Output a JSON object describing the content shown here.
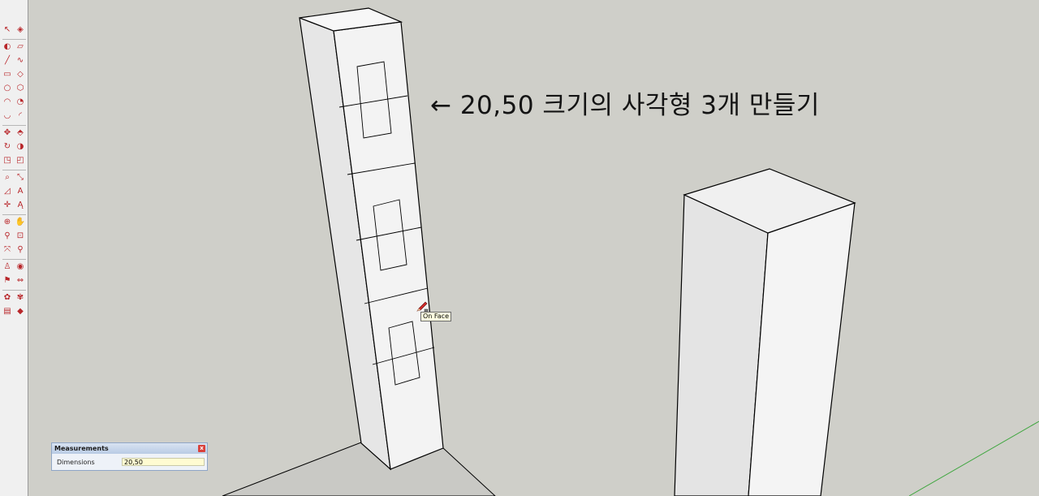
{
  "annotation": "← 20,50 크기의 사각형 3개 만들기",
  "tooltip": "On Face",
  "measurements": {
    "title": "Measurements",
    "close_glyph": "x",
    "label": "Dimensions",
    "value": "20,50"
  },
  "toolbar": {
    "tools": [
      {
        "name": "select-tool",
        "glyph": "↖"
      },
      {
        "name": "make-component-tool",
        "glyph": "◈"
      },
      {
        "name": "paint-bucket-tool",
        "glyph": "◐"
      },
      {
        "name": "eraser-tool",
        "glyph": "▱"
      },
      {
        "name": "line-tool",
        "glyph": "╱"
      },
      {
        "name": "freehand-tool",
        "glyph": "∿"
      },
      {
        "name": "rectangle-tool",
        "glyph": "▭"
      },
      {
        "name": "rotated-rectangle-tool",
        "glyph": "◇"
      },
      {
        "name": "circle-tool",
        "glyph": "○"
      },
      {
        "name": "polygon-tool",
        "glyph": "⬡"
      },
      {
        "name": "arc-tool",
        "glyph": "◠"
      },
      {
        "name": "pie-tool",
        "glyph": "◔"
      },
      {
        "name": "two-point-arc-tool",
        "glyph": "◡"
      },
      {
        "name": "three-point-arc-tool",
        "glyph": "◜"
      },
      {
        "name": "move-tool",
        "glyph": "✥"
      },
      {
        "name": "push-pull-tool",
        "glyph": "⬘"
      },
      {
        "name": "rotate-tool",
        "glyph": "↻"
      },
      {
        "name": "follow-me-tool",
        "glyph": "◑"
      },
      {
        "name": "scale-tool",
        "glyph": "◳"
      },
      {
        "name": "offset-tool",
        "glyph": "◰"
      },
      {
        "name": "tape-measure-tool",
        "glyph": "⌕"
      },
      {
        "name": "dimension-tool",
        "glyph": "⤡"
      },
      {
        "name": "protractor-tool",
        "glyph": "◿"
      },
      {
        "name": "text-tool",
        "glyph": "A"
      },
      {
        "name": "axes-tool",
        "glyph": "✛"
      },
      {
        "name": "3d-text-tool",
        "glyph": "Ą"
      },
      {
        "name": "orbit-tool",
        "glyph": "⊕"
      },
      {
        "name": "pan-tool",
        "glyph": "✋"
      },
      {
        "name": "zoom-tool",
        "glyph": "⚲"
      },
      {
        "name": "zoom-window-tool",
        "glyph": "⊡"
      },
      {
        "name": "zoom-extents-tool",
        "glyph": "⤧"
      },
      {
        "name": "previous-view-tool",
        "glyph": "⚲"
      },
      {
        "name": "position-camera-tool",
        "glyph": "♙"
      },
      {
        "name": "look-around-tool",
        "glyph": "◉"
      },
      {
        "name": "walk-tool",
        "glyph": "⚑"
      },
      {
        "name": "section-plane-tool",
        "glyph": "⇔"
      },
      {
        "name": "warehouse-tool",
        "glyph": "✿"
      },
      {
        "name": "share-model-tool",
        "glyph": "✾"
      },
      {
        "name": "extension-warehouse-tool",
        "glyph": "▤"
      },
      {
        "name": "ruby-console-tool",
        "glyph": "◆"
      }
    ]
  },
  "colors": {
    "background": "#cfcfc9",
    "ground": "#c7c7c3",
    "face_light": "#f2f2f2",
    "face_shadow": "#e3e3e3",
    "edge": "#000000",
    "green_axis": "#3ea63e"
  }
}
